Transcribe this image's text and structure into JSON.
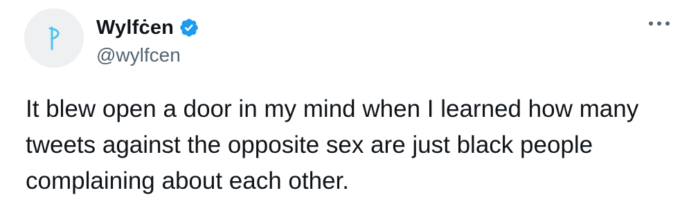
{
  "author": {
    "display_name": "Wylfċen",
    "handle": "@wylfcen",
    "avatar_icon": "rune-wynn-icon",
    "avatar_letter": "P",
    "verified": true
  },
  "tweet": {
    "text": "It blew open a door in my mind when I learned how many tweets against the opposite sex are just black people complaining about each other."
  },
  "colors": {
    "verified_blue": "#1d9bf0",
    "avatar_bg": "#eef0f2",
    "avatar_glyph": "#49c4f0",
    "text_primary": "#0f1419",
    "text_secondary": "#536471"
  },
  "icons": {
    "verified": "verified-badge-icon",
    "more": "more-options-icon"
  }
}
